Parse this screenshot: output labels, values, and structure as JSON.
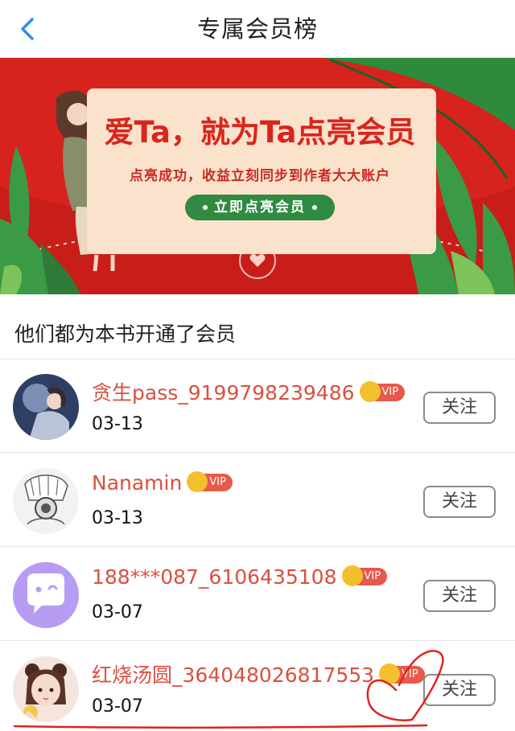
{
  "header": {
    "title": "专属会员榜"
  },
  "banner": {
    "headline": "爱Ta，就为Ta点亮会员",
    "subtitle": "点亮成功，收益立刻同步到作者大大账户",
    "cta_label": "立即点亮会员"
  },
  "section": {
    "title": "他们都为本书开通了会员"
  },
  "members": [
    {
      "name": "贪生pass_9199798239486",
      "date": "03-13",
      "badge": "VIP",
      "follow_label": "关注"
    },
    {
      "name": "Nanamin",
      "date": "03-13",
      "badge": "VIP",
      "follow_label": "关注"
    },
    {
      "name": "188***087_6106435108",
      "date": "03-07",
      "badge": "VIP",
      "follow_label": "关注"
    },
    {
      "name": "红烧汤圆_364048026817553",
      "date": "03-07",
      "badge": "VIP",
      "follow_label": "关注"
    }
  ],
  "colors": {
    "banner_red": "#d6231d",
    "name_red": "#d9503f",
    "vip_badge": "#e6594b",
    "back_blue": "#2b8ff2",
    "cta_green": "#2f8b3f"
  },
  "icons": [
    "chevron-left-icon",
    "crown-icon",
    "heart-seal-icon",
    "chat-bubble-icon"
  ]
}
